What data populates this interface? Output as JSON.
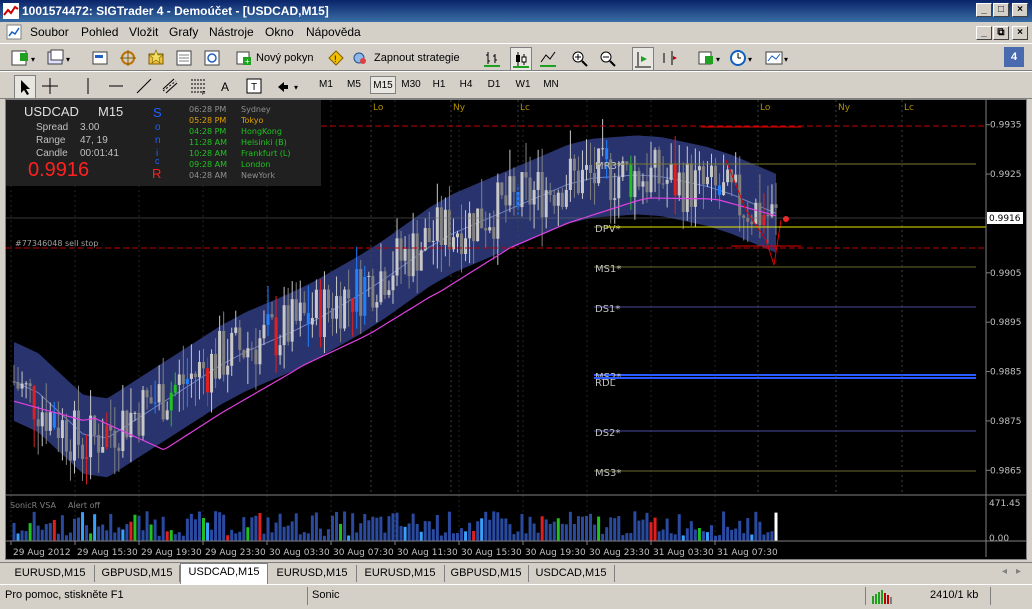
{
  "window": {
    "title": "1001574472: SIGTrader 4 - Demoúčet - [USDCAD,M15]"
  },
  "menu": [
    "Soubor",
    "Pohled",
    "Vložit",
    "Grafy",
    "Nástroje",
    "Okno",
    "Nápověda"
  ],
  "toolbar1": {
    "new_order": "Nový pokyn",
    "strategy": "Zapnout strategie"
  },
  "timeframes": [
    "M1",
    "M5",
    "M15",
    "M30",
    "H1",
    "H4",
    "D1",
    "W1",
    "MN"
  ],
  "selected_timeframe": "M15",
  "info": {
    "symbol": "USDCAD",
    "period": "M15",
    "spread_label": "Spread",
    "spread": "3.00",
    "range_label": "Range",
    "range": "47, 19",
    "candle_label": "Candle",
    "candle": "00:01:41",
    "price": "0.9916",
    "brand_letters": [
      "S",
      "o",
      "n",
      "i",
      "c",
      "R"
    ]
  },
  "sessions": [
    {
      "time": "06:28 PM",
      "city": "Sydney"
    },
    {
      "time": "05:28 PM",
      "city": "Tokyo"
    },
    {
      "time": "04:28 PM",
      "city": "HongKong"
    },
    {
      "time": "11:28 AM",
      "city": "Helsinki  (B)"
    },
    {
      "time": "10:28 AM",
      "city": "Frankfurt  (L)"
    },
    {
      "time": "09:28 AM",
      "city": "London"
    },
    {
      "time": "04:28 AM",
      "city": "NewYork"
    }
  ],
  "session_markers": [
    "Lo",
    "Ny",
    "Lc",
    "Lo",
    "Ny",
    "Lc"
  ],
  "pivot_labels": [
    "MR3*",
    "DPV*",
    "MS1*",
    "DS1*",
    "MS2*",
    "RDL",
    "DS2*",
    "MS3*"
  ],
  "stop_label": "#77346048 sell stop",
  "price_axis": [
    "0.9935",
    "0.9925",
    "0.9916",
    "0.9905",
    "0.9895",
    "0.9885",
    "0.9875",
    "0.9865"
  ],
  "indicator": {
    "name": "SonicR VSA",
    "note": "Alert off",
    "max": "471.45",
    "min": "0.00"
  },
  "time_axis": [
    "29 Aug 2012",
    "29 Aug 15:30",
    "29 Aug 19:30",
    "29 Aug 23:30",
    "30 Aug 03:30",
    "30 Aug 07:30",
    "30 Aug 11:30",
    "30 Aug 15:30",
    "30 Aug 19:30",
    "30 Aug 23:30",
    "31 Aug 03:30",
    "31 Aug 07:30"
  ],
  "tabs": [
    "EURUSD,M15",
    "GBPUSD,M15",
    "USDCAD,M15",
    "EURUSD,M15",
    "EURUSD,M15",
    "GBPUSD,M15",
    "USDCAD,M15"
  ],
  "active_tab": 2,
  "status": {
    "help": "Pro pomoc, stiskněte F1",
    "profile": "Sonic",
    "traffic": "2410/1 kb"
  },
  "colors": {
    "bull": "#c8c8c8",
    "bear": "#808080",
    "band": "#2e3a7a",
    "ma": "#e040e0",
    "price_line": "#e6e600"
  },
  "chart_data": {
    "type": "line",
    "title": "USDCAD M15",
    "x": [
      "29 Aug 2012",
      "29 Aug 15:30",
      "29 Aug 19:30",
      "29 Aug 23:30",
      "30 Aug 03:30",
      "30 Aug 07:30",
      "30 Aug 11:30",
      "30 Aug 15:30",
      "30 Aug 19:30",
      "30 Aug 23:30",
      "31 Aug 03:30",
      "31 Aug 07:30"
    ],
    "series": [
      {
        "values": [
          0.9883,
          0.987,
          0.9879,
          0.9888,
          0.9894,
          0.9902,
          0.9912,
          0.9918,
          0.9924,
          0.9925,
          0.9922,
          0.9916
        ]
      }
    ],
    "ylim": [
      0.986,
      0.994
    ],
    "last_price": 0.9916
  }
}
